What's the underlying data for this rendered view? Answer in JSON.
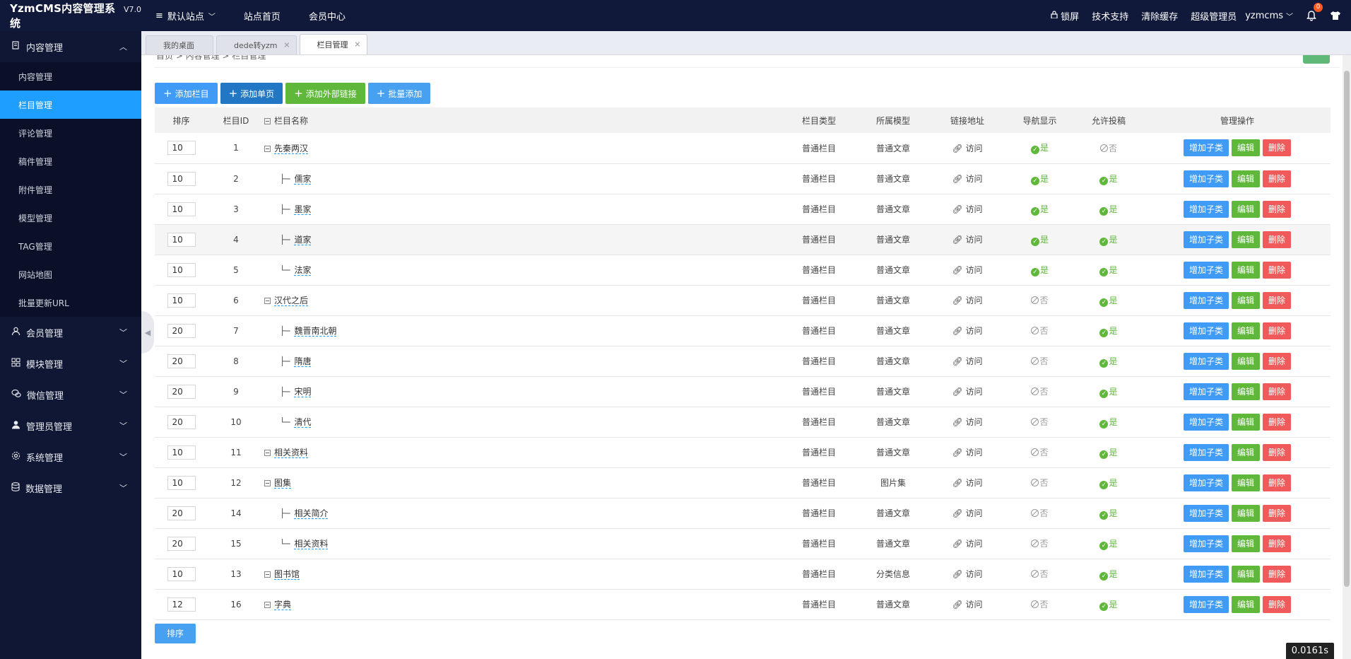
{
  "app": {
    "title": "YzmCMS内容管理系统",
    "version": "V7.0"
  },
  "topnav": {
    "site": "默认站点",
    "home": "站点首页",
    "member": "会员中心"
  },
  "topright": {
    "lock": "锁屏",
    "support": "技术支持",
    "clear_cache": "清除缓存",
    "role": "超级管理员",
    "user": "yzmcms",
    "notif_count": "0"
  },
  "sidebar": {
    "content_section": "内容管理",
    "sub_items": [
      "内容管理",
      "栏目管理",
      "评论管理",
      "稿件管理",
      "附件管理",
      "模型管理",
      "TAG管理",
      "网站地图",
      "批量更新URL"
    ],
    "sections": [
      "会员管理",
      "模块管理",
      "微信管理",
      "管理员管理",
      "系统管理",
      "数据管理"
    ]
  },
  "tabs": [
    "我的桌面",
    "dede转yzm",
    "栏目管理"
  ],
  "breadcrumb": "首页 > 内容管理 > 栏目管理",
  "toolbar": {
    "add_category": "添加栏目",
    "add_page": "添加单页",
    "add_link": "添加外部链接",
    "batch_add": "批量添加"
  },
  "table": {
    "headers": {
      "order": "排序",
      "id": "栏目ID",
      "name": "栏目名称",
      "type": "栏目类型",
      "model": "所属模型",
      "link": "链接地址",
      "nav": "导航显示",
      "submit": "允许投稿",
      "ops": "管理操作"
    },
    "rows": [
      {
        "order": "10",
        "id": "1",
        "prefix": "",
        "name": "先秦两汉",
        "type": "普通栏目",
        "model": "普通文章",
        "nav": "是",
        "submit": "否"
      },
      {
        "order": "10",
        "id": "2",
        "prefix": "├─",
        "name": "儒家",
        "type": "普通栏目",
        "model": "普通文章",
        "nav": "是",
        "submit": "是"
      },
      {
        "order": "10",
        "id": "3",
        "prefix": "├─",
        "name": "墨家",
        "type": "普通栏目",
        "model": "普通文章",
        "nav": "是",
        "submit": "是"
      },
      {
        "order": "10",
        "id": "4",
        "prefix": "├─",
        "name": "道家",
        "type": "普通栏目",
        "model": "普通文章",
        "nav": "是",
        "submit": "是"
      },
      {
        "order": "10",
        "id": "5",
        "prefix": "└─",
        "name": "法家",
        "type": "普通栏目",
        "model": "普通文章",
        "nav": "是",
        "submit": "是"
      },
      {
        "order": "10",
        "id": "6",
        "prefix": "",
        "name": "汉代之后",
        "type": "普通栏目",
        "model": "普通文章",
        "nav": "否",
        "submit": "是"
      },
      {
        "order": "20",
        "id": "7",
        "prefix": "├─",
        "name": "魏晋南北朝",
        "type": "普通栏目",
        "model": "普通文章",
        "nav": "否",
        "submit": "是"
      },
      {
        "order": "20",
        "id": "8",
        "prefix": "├─",
        "name": "隋唐",
        "type": "普通栏目",
        "model": "普通文章",
        "nav": "否",
        "submit": "是"
      },
      {
        "order": "20",
        "id": "9",
        "prefix": "├─",
        "name": "宋明",
        "type": "普通栏目",
        "model": "普通文章",
        "nav": "否",
        "submit": "是"
      },
      {
        "order": "20",
        "id": "10",
        "prefix": "└─",
        "name": "清代",
        "type": "普通栏目",
        "model": "普通文章",
        "nav": "否",
        "submit": "是"
      },
      {
        "order": "10",
        "id": "11",
        "prefix": "",
        "name": "相关资料",
        "type": "普通栏目",
        "model": "普通文章",
        "nav": "否",
        "submit": "是"
      },
      {
        "order": "10",
        "id": "12",
        "prefix": "",
        "name": "图集",
        "type": "普通栏目",
        "model": "图片集",
        "nav": "否",
        "submit": "是"
      },
      {
        "order": "20",
        "id": "14",
        "prefix": "├─",
        "name": "相关简介",
        "type": "普通栏目",
        "model": "普通文章",
        "nav": "否",
        "submit": "是"
      },
      {
        "order": "20",
        "id": "15",
        "prefix": "└─",
        "name": "相关资料",
        "type": "普通栏目",
        "model": "普通文章",
        "nav": "否",
        "submit": "是"
      },
      {
        "order": "10",
        "id": "13",
        "prefix": "",
        "name": "图书馆",
        "type": "普通栏目",
        "model": "分类信息",
        "nav": "否",
        "submit": "是"
      },
      {
        "order": "12",
        "id": "16",
        "prefix": "",
        "name": "字典",
        "type": "普通栏目",
        "model": "普通文章",
        "nav": "否",
        "submit": "是"
      }
    ],
    "visit_label": "访问",
    "actions": {
      "add_child": "增加子类",
      "edit": "编辑",
      "delete": "删除"
    }
  },
  "sort_button": "排序",
  "timer": "0.0161s",
  "colors": {
    "topbar": "#11193a",
    "sidebar": "#0f1734",
    "active": "#1e9fff",
    "green": "#5fb83a",
    "red": "#f05a5a"
  }
}
